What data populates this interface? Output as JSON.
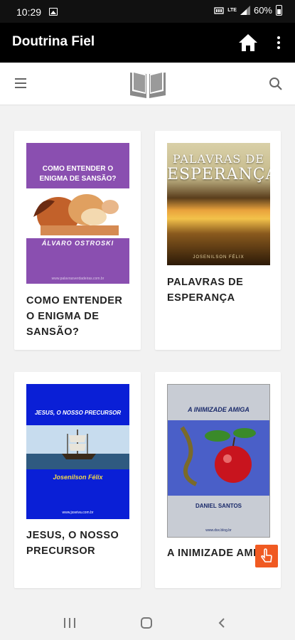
{
  "status": {
    "time": "10:29",
    "signal_label": "LTE",
    "battery": "60%"
  },
  "appbar": {
    "title": "Doutrina Fiel"
  },
  "books": [
    {
      "caption": "COMO ENTENDER O ENIGMA DE SANSÃO?",
      "cover_title": "COMO ENTENDER O ENIGMA DE SANSÃO?",
      "cover_author": "ÁLVARO OSTROSKI",
      "cover_url": "www.palavrasverdadeiras.com.br"
    },
    {
      "caption": "PALAVRAS DE ESPERANÇA",
      "cover_title_line1": "PALAVRAS DE",
      "cover_title_line2": "ESPERANÇA",
      "cover_author": "JOSENILSON FÉLIX"
    },
    {
      "caption": "JESUS, O NOSSO PRECURSOR",
      "cover_title": "JESUS, O NOSSO PRECURSOR",
      "cover_author": "Josenilson Félix",
      "cover_url": "www.jsseiva.com.br"
    },
    {
      "caption": "A INIMIZADE AMIGA",
      "cover_title": "A INIMIZADE AMIGA",
      "cover_author": "DANIEL SANTOS",
      "cover_url": "www.dsx.blog.br"
    }
  ],
  "colors": {
    "appbar": "#000000",
    "accent": "#f05a22",
    "cover_purple": "#8a4fb0",
    "cover_blue": "#0a1fd6"
  },
  "icons": {
    "home": "home-icon",
    "more": "more-vert-icon",
    "menu": "hamburger-menu-icon",
    "logo": "open-book-logo-icon",
    "search": "search-icon",
    "touch": "touch-hand-icon"
  }
}
